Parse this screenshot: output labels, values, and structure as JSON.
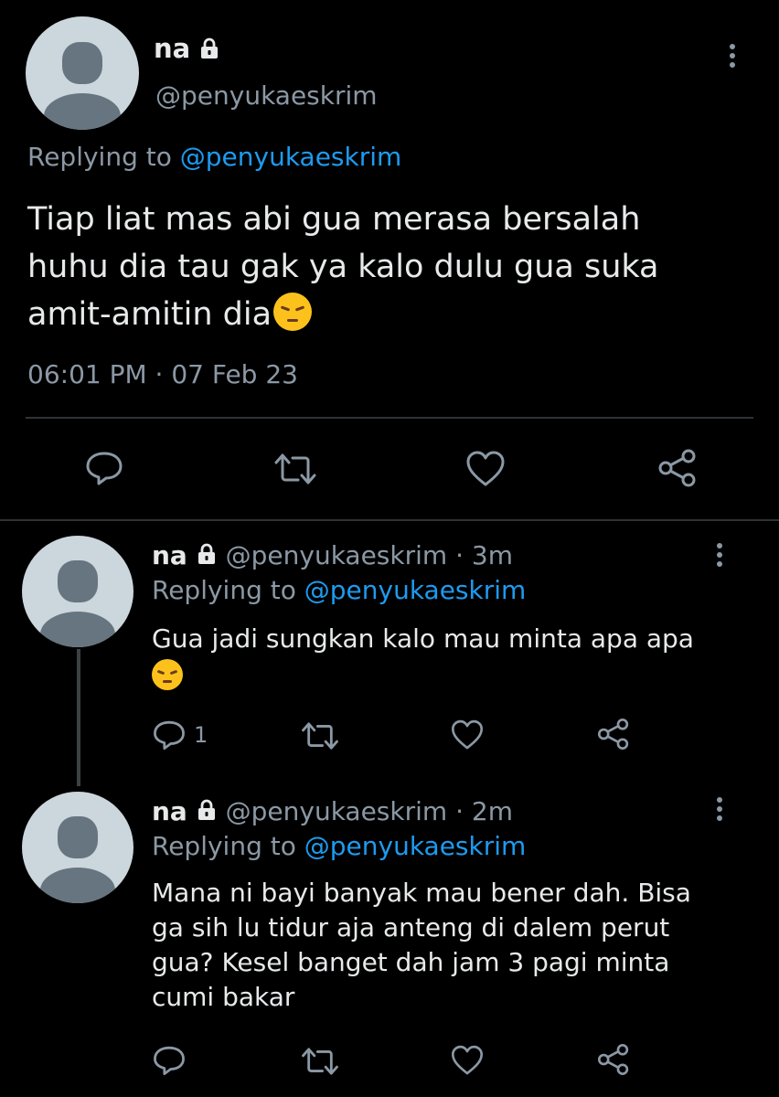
{
  "main_tweet": {
    "name": "na",
    "handle": "@penyukaeskrim",
    "replying_prefix": "Replying to",
    "replying_handle": "@penyukaeskrim",
    "text_line1": "Tiap liat mas abi gua merasa bersalah",
    "text_line2": "huhu dia tau gak ya kalo dulu gua suka",
    "text_line3": "amit-amitin dia",
    "emoji": "pensive-face",
    "timestamp": "06:01 PM · 07 Feb 23"
  },
  "replies": [
    {
      "name": "na",
      "handle": "@penyukaeskrim",
      "time": "· 3m",
      "replying_prefix": "Replying to",
      "replying_handle": "@penyukaeskrim",
      "text_line1": "Gua jadi sungkan kalo mau minta apa apa",
      "emoji": "pensive-face",
      "reply_count": "1"
    },
    {
      "name": "na",
      "handle": "@penyukaeskrim",
      "time": "· 2m",
      "replying_prefix": "Replying to",
      "replying_handle": "@penyukaeskrim",
      "text_line1": "Mana ni bayi banyak mau bener dah. Bisa",
      "text_line2": "ga sih lu tidur aja anteng di dalem perut",
      "text_line3": "gua? Kesel banget dah jam 3 pagi minta",
      "text_line4": "cumi bakar"
    }
  ],
  "colors": {
    "background": "#000000",
    "text": "#e7e9ea",
    "secondary": "#8b98a5",
    "link": "#1d9bf0",
    "divider": "#2f3336"
  }
}
